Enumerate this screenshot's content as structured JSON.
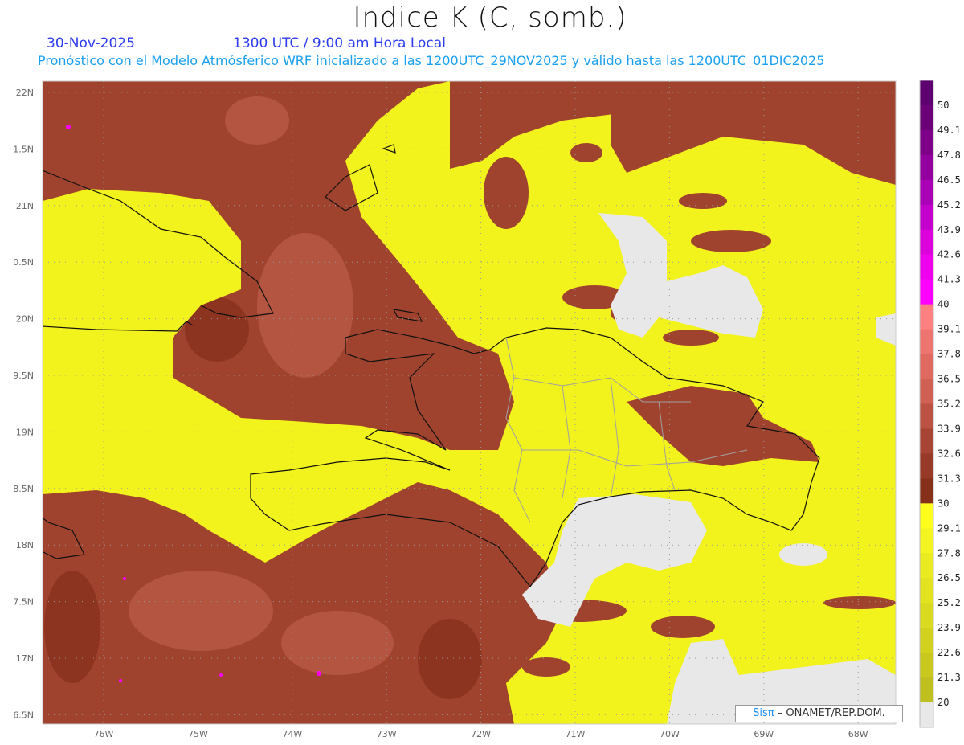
{
  "header": {
    "title": "Indice K (C, somb.)",
    "date": "30-Nov-2025",
    "time": "1300 UTC / 9:00 am Hora Local",
    "subtitle": "Pronóstico con el Modelo Atmósferico WRF inicializado a las 1200UTC_29NOV2025 y válido hasta las  1200UTC_01DIC2025"
  },
  "map": {
    "lat_labels": [
      "22N",
      "1.5N",
      "21N",
      "0.5N",
      "20N",
      "9.5N",
      "19N",
      "8.5N",
      "18N",
      "7.5N",
      "17N",
      "6.5N"
    ],
    "lon_labels": [
      "76W",
      "75W",
      "74W",
      "73W",
      "72W",
      "71W",
      "70W",
      "69W",
      "68W"
    ],
    "colors": {
      "high_brown": "#a0432e",
      "light_brown": "#c26450",
      "yellow": "#f2f21c",
      "gray": "#e8e8e8",
      "coast": "#111111",
      "borders": "#a0a0a0"
    }
  },
  "colorbar": {
    "labels": [
      "50",
      "49.1",
      "47.8",
      "46.5",
      "45.2",
      "43.9",
      "42.6",
      "41.3",
      "40",
      "39.1",
      "37.8",
      "36.5",
      "35.2",
      "33.9",
      "32.6",
      "31.3",
      "30",
      "29.1",
      "27.8",
      "26.5",
      "25.2",
      "23.9",
      "22.6",
      "21.3",
      "20"
    ],
    "colors": [
      "#5e0070",
      "#6c0078",
      "#7e0088",
      "#9400a0",
      "#aa00b8",
      "#c400cc",
      "#dc00dc",
      "#ee00ee",
      "#ff00ff",
      "#ff8080",
      "#ee7470",
      "#e06a60",
      "#cf6052",
      "#bb5242",
      "#a84434",
      "#983a28",
      "#86301a",
      "#ffff1e",
      "#f4f420",
      "#eaea20",
      "#e2e220",
      "#dada20",
      "#d2d21e",
      "#c8c81e",
      "#bfbf20",
      "#e8e8e8"
    ]
  },
  "credit": {
    "logo": "Sisπ",
    "text": "– ONAMET/REP.DOM."
  }
}
